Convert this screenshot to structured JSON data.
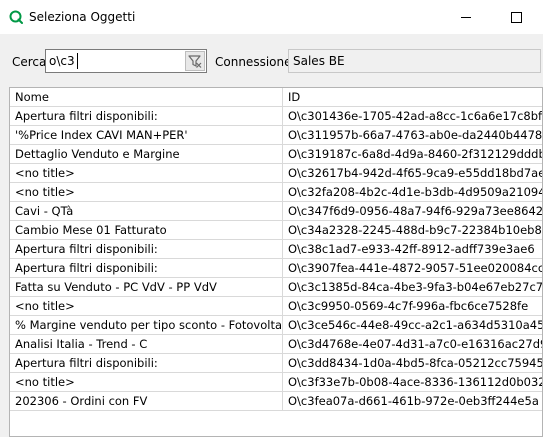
{
  "window": {
    "title": "Seleziona Oggetti",
    "icon": "qlik-q-icon",
    "accent": "#009845"
  },
  "search": {
    "label": "Cerca",
    "value": "o\\c3",
    "filter_icon": "filter-clear-icon"
  },
  "connection": {
    "label": "Connessione",
    "value": "Sales BE"
  },
  "table": {
    "columns": [
      "Nome",
      "ID"
    ],
    "rows": [
      {
        "name": "Apertura filtri disponibili:",
        "id": "O\\c301436e-1705-42ad-a8cc-1c6a6e17c8bf"
      },
      {
        "name": "'%Price Index CAVI MAN+PER'",
        "id": "O\\c311957b-66a7-4763-ab0e-da2440b44789"
      },
      {
        "name": "Dettaglio Venduto e Margine",
        "id": "O\\c319187c-6a8d-4d9a-8460-2f312129dddb"
      },
      {
        "name": "<no title>",
        "id": "O\\c32617b4-942d-4f65-9ca9-e55dd18bd7ae"
      },
      {
        "name": "<no title>",
        "id": "O\\c32fa208-4b2c-4d1e-b3db-4d9509a21094"
      },
      {
        "name": "Cavi - QTà",
        "id": "O\\c347f6d9-0956-48a7-94f6-929a73ee8642"
      },
      {
        "name": "Cambio Mese 01 Fatturato",
        "id": "O\\c34a2328-2245-488d-b9c7-22384b10eb84"
      },
      {
        "name": "Apertura filtri disponibili:",
        "id": "O\\c38c1ad7-e933-42ff-8912-adff739e3ae6"
      },
      {
        "name": "Apertura filtri disponibili:",
        "id": "O\\c3907fea-441e-4872-9057-51ee020084cc"
      },
      {
        "name": "Fatta su Venduto - PC VdV - PP VdV",
        "id": "O\\c3c1385d-84ca-4be3-9fa3-b04e67eb27c7"
      },
      {
        "name": "<no title>",
        "id": "O\\c3c9950-0569-4c7f-996a-fbc6ce7528fe"
      },
      {
        "name": "% Margine venduto per tipo sconto - Fotovoltaico",
        "id": "O\\c3ce546c-44e8-49cc-a2c1-a634d5310a45"
      },
      {
        "name": "Analisi Italia - Trend - C",
        "id": "O\\c3d4768e-4e07-4d31-a7c0-e16316ac27d9"
      },
      {
        "name": "Apertura filtri disponibili:",
        "id": "O\\c3dd8434-1d0a-4bd5-8fca-05212cc75945"
      },
      {
        "name": "<no title>",
        "id": "O\\c3f33e7b-0b08-4ace-8336-136112d0b032"
      },
      {
        "name": "202306 - Ordini con FV",
        "id": "O\\c3fea07a-d661-461b-972e-0eb3ff244e5a"
      }
    ]
  }
}
